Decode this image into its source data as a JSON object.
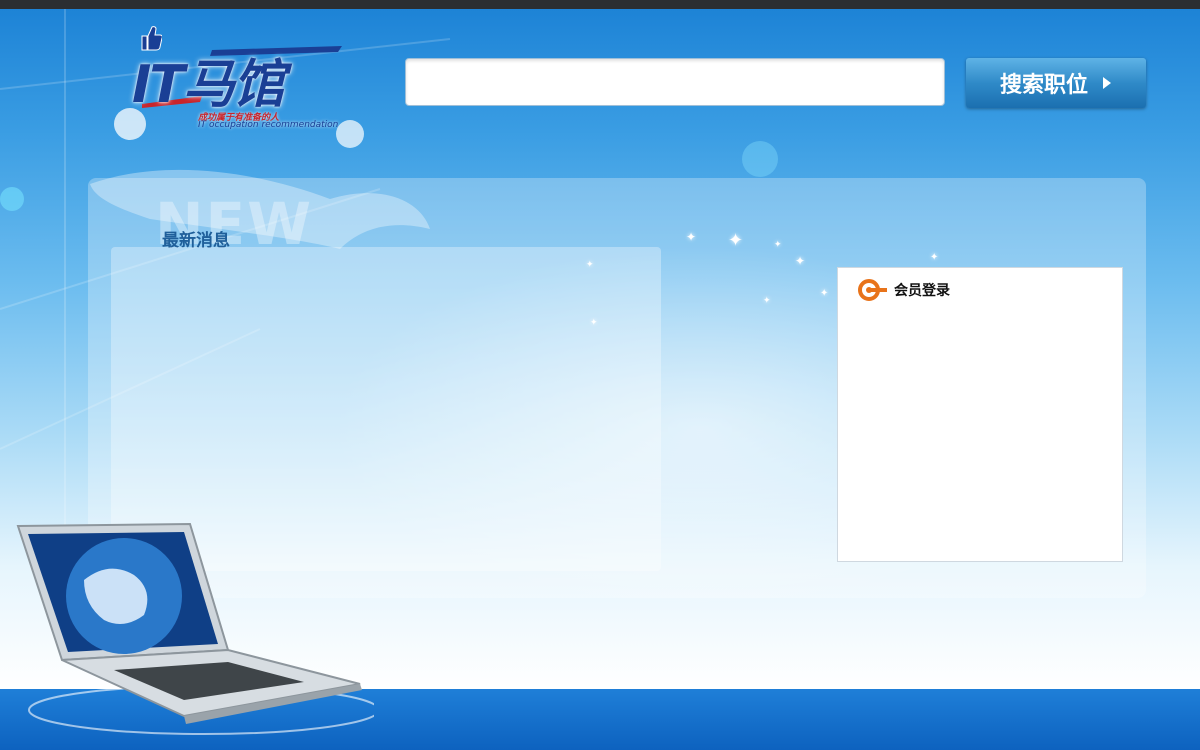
{
  "logo": {
    "text": "IT马馆",
    "slogan": "成功属于有准备的人",
    "english": "IT occupation recommendation"
  },
  "search": {
    "value": "",
    "placeholder": "",
    "button_label": "搜索职位"
  },
  "news": {
    "watermark": "NEW",
    "title": "最新消息"
  },
  "login": {
    "title": "会员登录"
  },
  "colors": {
    "accent": "#1a3f95",
    "button": "#2f8ac8",
    "login_icon": "#e8731a"
  }
}
